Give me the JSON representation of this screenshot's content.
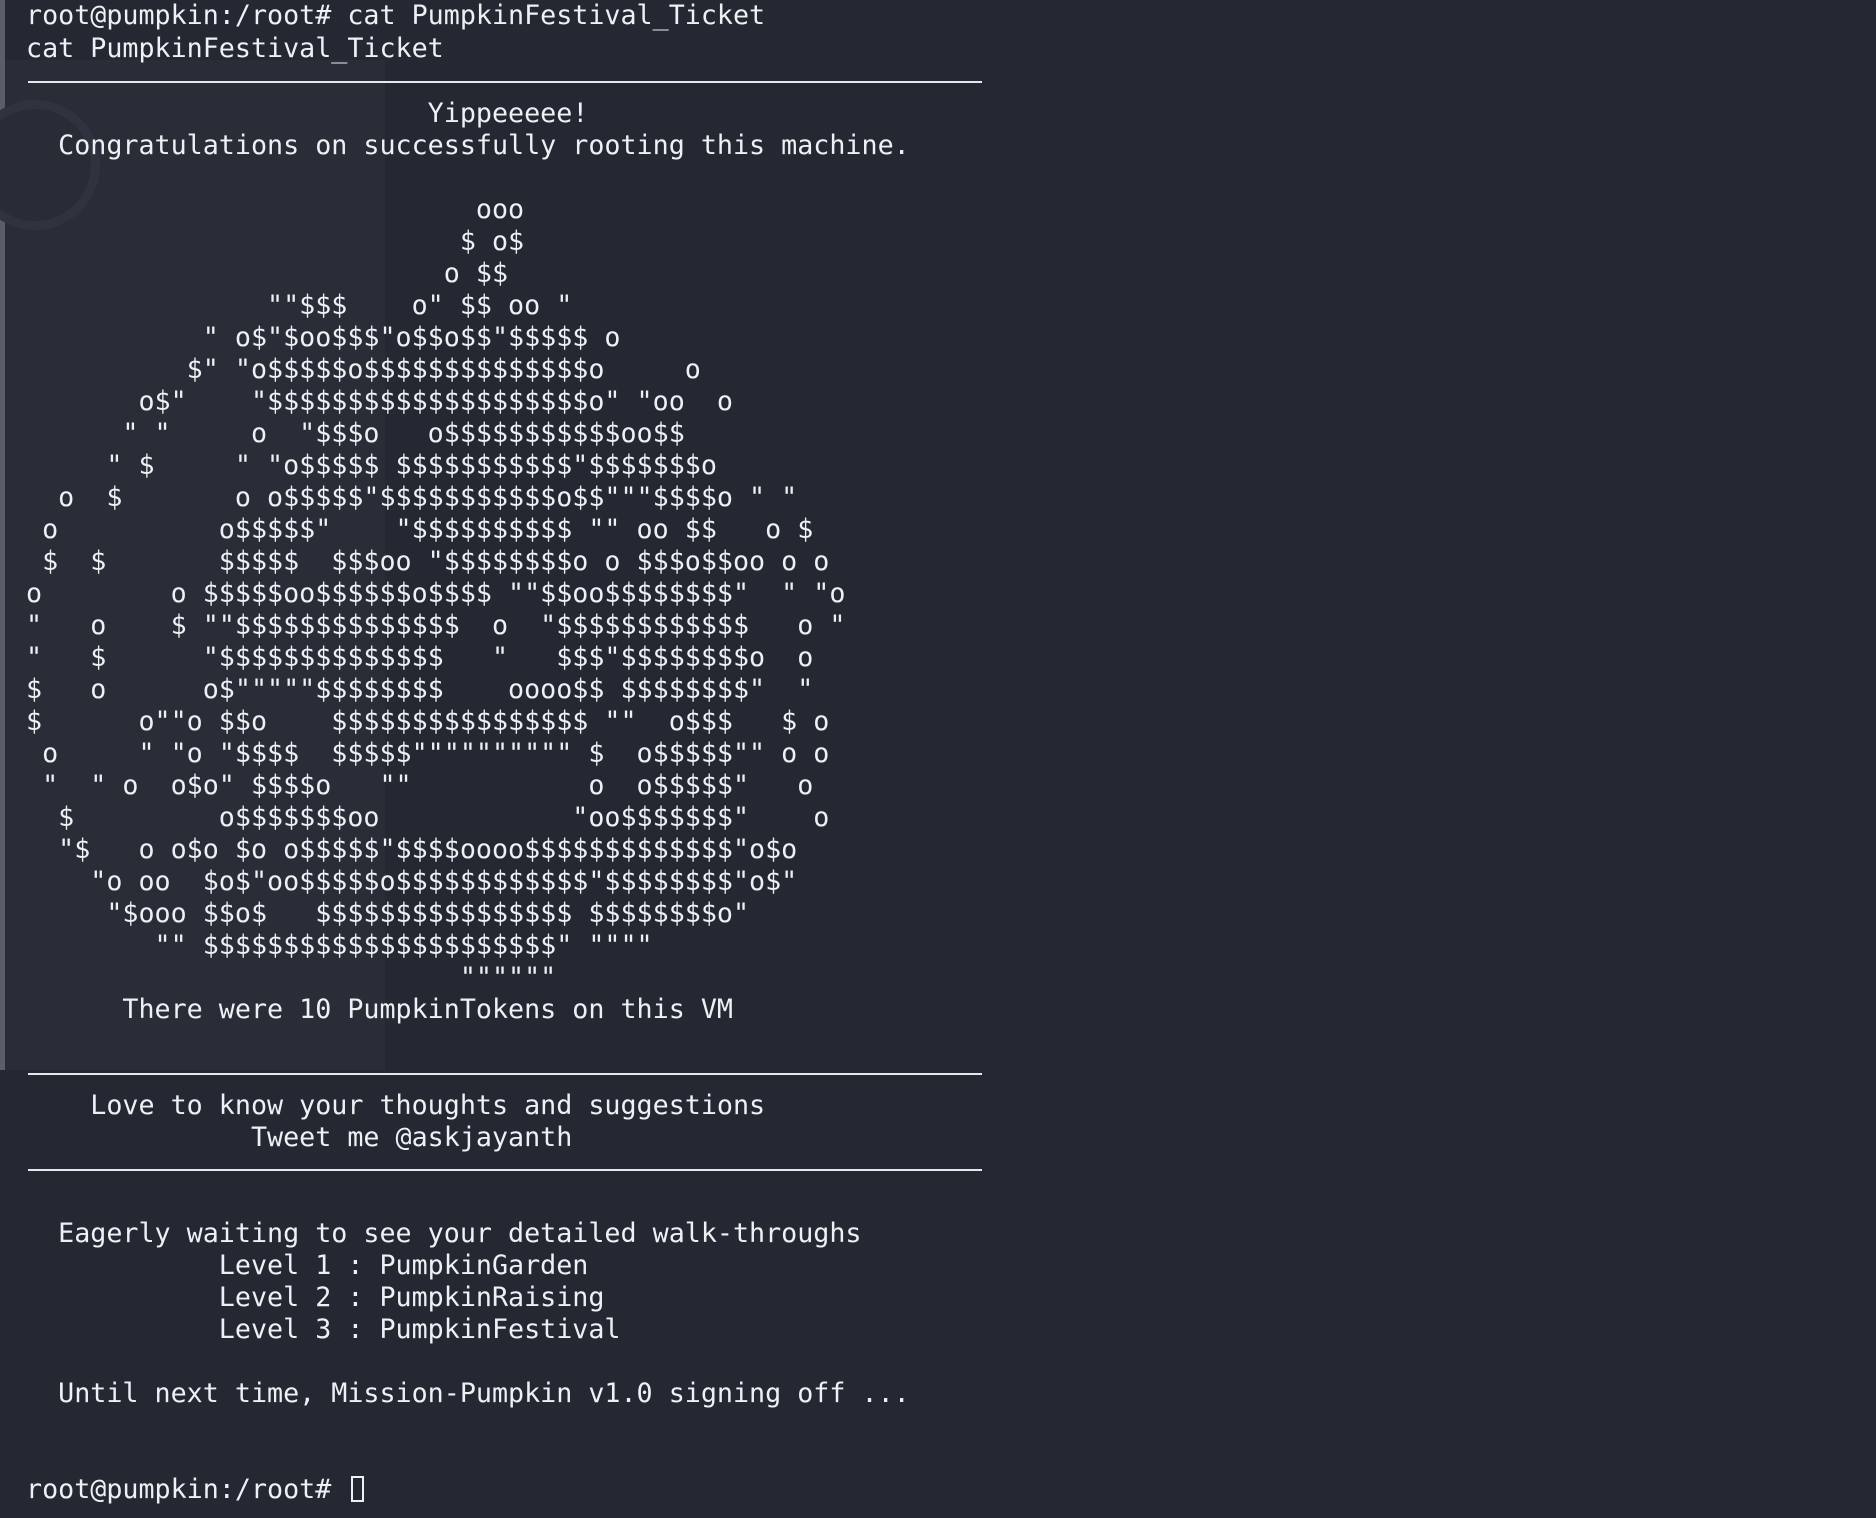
{
  "terminal": {
    "command_line": "root@pumpkin:/root# cat PumpkinFestival_Ticket",
    "echo_line": "cat PumpkinFestival_Ticket",
    "yippee": "                         Yippeeeee!",
    "congrats": "  Congratulations on successfully rooting this machine.",
    "art": [
      "                            ooo",
      "                           $ o$",
      "                          o $$",
      "               \"\"$$$    o\" $$ oo \"",
      "           \" o$\"$oo$$$\"o$$o$$\"$$$$$ o",
      "          $\" \"o$$$$$o$$$$$$$$$$$$$$o     o",
      "       o$\"    \"$$$$$$$$$$$$$$$$$$$$o\" \"oo  o",
      "      \" \"     o  \"$$$o   o$$$$$$$$$$$oo$$",
      "     \" $     \" \"o$$$$$ $$$$$$$$$$$\"$$$$$$$o",
      "  o  $       o o$$$$$\"$$$$$$$$$$$o$$\"\"\"$$$$o \" \"",
      " o          o$$$$$\"    \"$$$$$$$$$$ \"\" oo $$   o $",
      " $  $       $$$$$  $$$oo \"$$$$$$$$o o $$$o$$oo o o",
      "o        o $$$$$oo$$$$$$o$$$$ \"\"$$oo$$$$$$$$\"  \" \"o",
      "\"   o    $ \"\"$$$$$$$$$$$$$$  o  \"$$$$$$$$$$$$   o \"",
      "\"   $      \"$$$$$$$$$$$$$$   \"   $$$\"$$$$$$$$o  o",
      "$   o      o$\"\"\"\"\"$$$$$$$$    oooo$$ $$$$$$$$\"  \"",
      "$      o\"\"o $$o    $$$$$$$$$$$$$$$$ \"\"  o$$$   $ o",
      " o     \" \"o \"$$$$  $$$$$\"\"\"\"\"\"\"\"\"\" $  o$$$$$\"\" o o",
      " \"  \" o  o$o\" $$$$o   \"\"           o  o$$$$$\"   o",
      "  $         o$$$$$$$oo            \"oo$$$$$$$\"    o",
      "  \"$   o o$o $o o$$$$$\"$$$$oooo$$$$$$$$$$$$$\"o$o",
      "    \"o oo  $o$\"oo$$$$$o$$$$$$$$$$$$\"$$$$$$$$\"o$\"",
      "     \"$ooo $$o$   $$$$$$$$$$$$$$$$ $$$$$$$$o\"",
      "        \"\" $$$$$$$$$$$$$$$$$$$$$$\" \"\"\"\"",
      "                           \"\"\"\"\"\""
    ],
    "tokens": "      There were 10 PumpkinTokens on this VM",
    "love": "    Love to know your thoughts and suggestions",
    "tweet": "              Tweet me @askjayanth",
    "eager": "  Eagerly waiting to see your detailed walk-throughs",
    "level1": "            Level 1 : PumpkinGarden",
    "level2": "            Level 2 : PumpkinRaising",
    "level3": "            Level 3 : PumpkinFestival",
    "until": "  Until next time, Mission-Pumpkin v1.0 signing off ...",
    "prompt": "root@pumpkin:/root# "
  }
}
